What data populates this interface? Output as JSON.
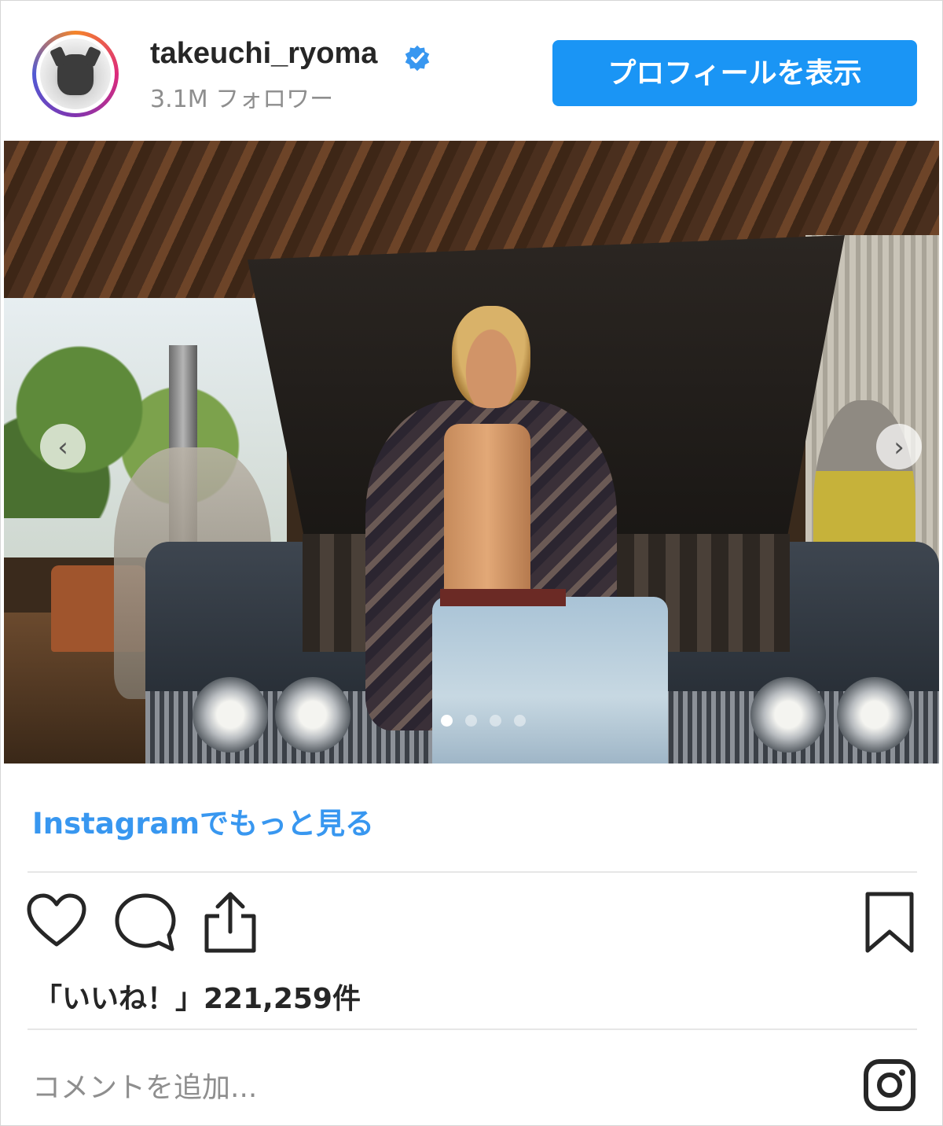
{
  "header": {
    "username": "takeuchi_ryoma",
    "verified": true,
    "followers": "3.1M フォロワー",
    "profile_button": "プロフィールを表示"
  },
  "media": {
    "carousel_total": 4,
    "carousel_index": 1,
    "prev_arrow": "‹",
    "next_arrow": "›"
  },
  "links": {
    "more_on_instagram": "Instagramでもっと見る"
  },
  "actions": {
    "icons": [
      "heart-icon",
      "comment-icon",
      "share-icon",
      "bookmark-icon"
    ]
  },
  "likes": {
    "text": "「いいね！」221,259件"
  },
  "comment": {
    "placeholder": "コメントを追加..."
  },
  "colors": {
    "accent": "#1a95f5",
    "link": "#3897f0",
    "muted": "#8e8e8e",
    "verified": "#3897f0"
  }
}
